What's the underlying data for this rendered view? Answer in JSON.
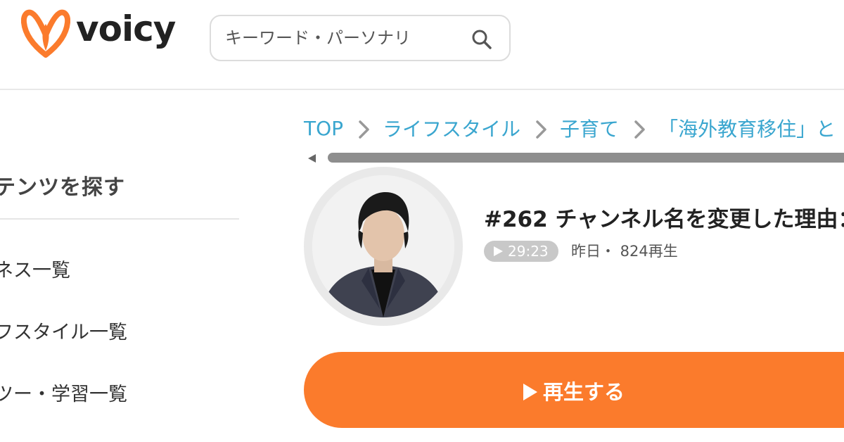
{
  "header": {
    "logo_text": "voicy",
    "search": {
      "placeholder": "キーワード・パーソナリ",
      "value": ""
    }
  },
  "sidebar": {
    "title": "テンツを探す",
    "items": [
      {
        "label": "ネス一覧"
      },
      {
        "label": "フスタイル一覧"
      },
      {
        "label": "ツー・学習一覧"
      }
    ]
  },
  "breadcrumb": [
    {
      "label": "TOP"
    },
    {
      "label": "ライフスタイル"
    },
    {
      "label": "子育て"
    },
    {
      "label": "「海外教育移住」と"
    }
  ],
  "episode": {
    "title": "#262 チャンネル名を変更した理由：",
    "duration": "29:23",
    "meta": "昨日・ 824再生",
    "play_label": "再生する"
  },
  "colors": {
    "brand_orange": "#fb7b2c",
    "link_blue": "#3aa6cf",
    "duration_badge": "#c8c8c8"
  },
  "icons": [
    "voicy-logo-icon",
    "search-icon",
    "chevron-right-icon",
    "scroll-left-icon",
    "play-icon"
  ]
}
